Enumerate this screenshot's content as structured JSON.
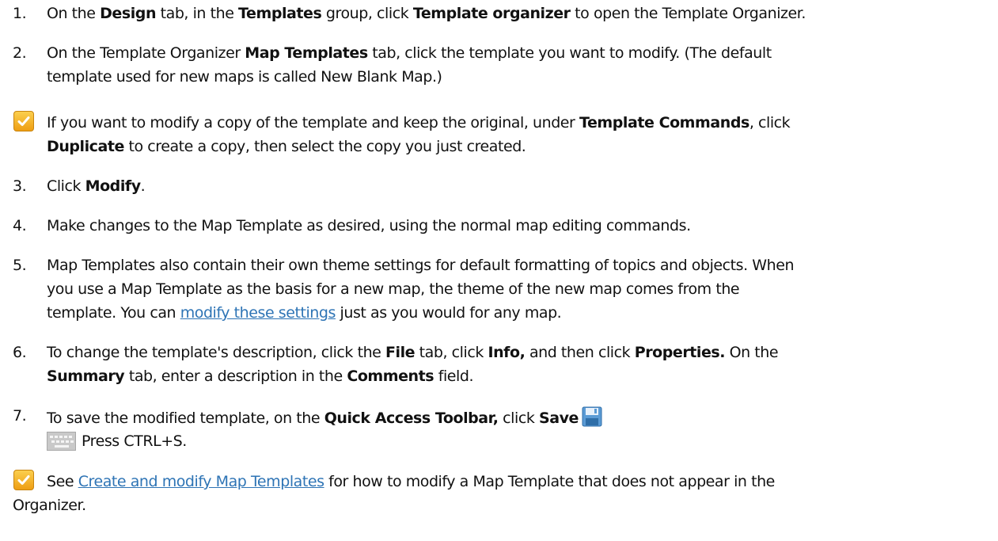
{
  "step1": {
    "num": "1.",
    "t1": "On the ",
    "b1": "Design",
    "t2": " tab, in the ",
    "b2": "Templates",
    "t3": " group, click ",
    "b3": "Template organizer",
    "t4": " to open the Template Organizer."
  },
  "step2": {
    "num": "2.",
    "t1": "On the Template Organizer ",
    "b1": "Map Templates",
    "t2": " tab, click the template you want to modify. (The default",
    "line2": "template used for new maps is called New Blank Map.)"
  },
  "tip1": {
    "icon": "checkmark-icon",
    "t1": "If you want to modify a copy of the template and keep the original, under ",
    "b1": "Template Commands",
    "t2": ", click",
    "b2": "Duplicate",
    "t3": " to create a copy, then select the copy you just created."
  },
  "step3": {
    "num": "3.",
    "t1": "Click ",
    "b1": "Modify",
    "t2": "."
  },
  "step4": {
    "num": "4.",
    "t1": "Make changes to the Map Template as desired, using the normal map editing commands."
  },
  "step5": {
    "num": "5.",
    "line1": "Map Templates also contain their own theme settings for default formatting of topics and objects. When",
    "line2": "you use a Map Template as the basis for a new map, the theme of the new map comes from the",
    "t1": "template. You can ",
    "link": "modify these settings",
    "t2": " just as you would for any map."
  },
  "step6": {
    "num": "6.",
    "t1": "To change the template's description, click the ",
    "b1": "File",
    "t2": " tab, click ",
    "b2": "Info,",
    "t3": " and then click ",
    "b3": "Properties.",
    "t4": " On the",
    "b4": "Summary",
    "t5": " tab, enter a description in the ",
    "b5": "Comments",
    "t6": " field."
  },
  "step7": {
    "num": "7.",
    "t1": "To save the modified template, on the ",
    "b1": "Quick Access Toolbar,",
    "t2": " click ",
    "b2": "Save",
    "icon": "save-icon"
  },
  "shortcut": {
    "icon": "keyboard-icon",
    "text": "Press CTRL+S."
  },
  "tip2": {
    "icon": "checkmark-icon",
    "t1": "See ",
    "link": "Create and modify Map Templates",
    "t2": " for how to modify a Map Template that does not appear in the",
    "line2": "Organizer."
  },
  "colors": {
    "link": "#2e74b5",
    "text": "#111111",
    "tip_icon": "#f0a81c"
  }
}
